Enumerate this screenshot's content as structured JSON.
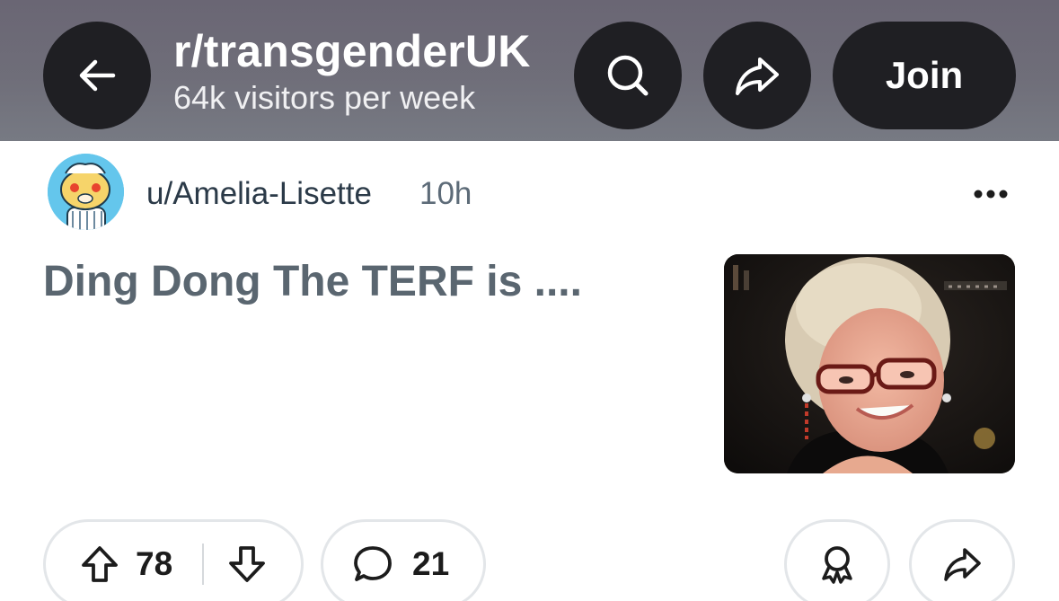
{
  "header": {
    "subreddit": "r/transgenderUK",
    "visitors": "64k visitors per week",
    "join_label": "Join",
    "icons": {
      "back": "arrow-left-icon",
      "search": "search-icon",
      "share": "share-icon"
    },
    "background": "#6f6e79",
    "button_color": "#1f1f23"
  },
  "post": {
    "author": "u/Amelia-Lisette",
    "time": "10h",
    "title": "Ding Dong The TERF is ....",
    "title_color": "#5a6670",
    "thumbnail": "portrait-photo"
  },
  "actions": {
    "upvotes": "78",
    "comments": "21",
    "icons": {
      "upvote": "upvote-arrow-icon",
      "downvote": "downvote-arrow-icon",
      "comment": "comment-bubble-icon",
      "award": "award-icon",
      "share": "share-icon"
    }
  }
}
